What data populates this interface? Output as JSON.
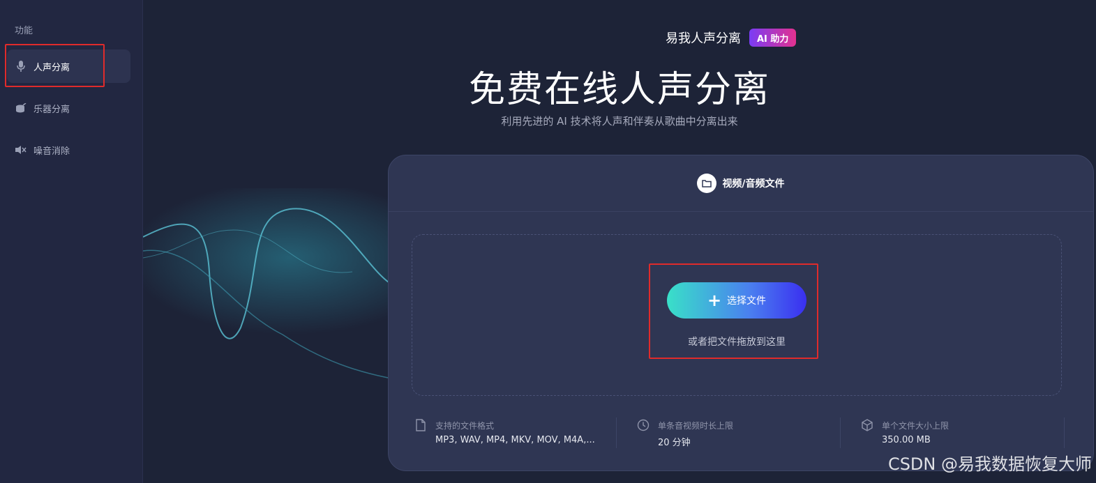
{
  "sidebar": {
    "title": "功能",
    "items": [
      {
        "label": "人声分离",
        "icon": "microphone-icon",
        "active": true
      },
      {
        "label": "乐器分离",
        "icon": "drum-icon",
        "active": false
      },
      {
        "label": "噪音消除",
        "icon": "speaker-icon",
        "active": false
      }
    ]
  },
  "header": {
    "brand": "易我人声分离",
    "badge": "AI 助力",
    "title": "免费在线人声分离",
    "subtitle": "利用先进的 AI 技术将人声和伴奏从歌曲中分离出来"
  },
  "card": {
    "tab_label": "视频/音频文件",
    "choose_button": "选择文件",
    "drop_hint": "或者把文件拖放到这里",
    "info": [
      {
        "label": "支持的文件格式",
        "value": "MP3, WAV, MP4, MKV, MOV, M4A,...",
        "icon": "file-icon"
      },
      {
        "label": "单条音视频时长上限",
        "value": "20 分钟",
        "icon": "clock-icon"
      },
      {
        "label": "单个文件大小上限",
        "value": "350.00 MB",
        "icon": "cube-icon"
      }
    ]
  },
  "watermark": "CSDN @易我数据恢复大师",
  "colors": {
    "background": "#1d2337",
    "sidebar": "#222741",
    "card": "#2f3653",
    "accent_gradient_start": "#39e0c8",
    "accent_gradient_end": "#3a2ff0",
    "badge_gradient_start": "#7a3cf5",
    "badge_gradient_end": "#e3318f",
    "highlight_box": "#e02b2b"
  }
}
